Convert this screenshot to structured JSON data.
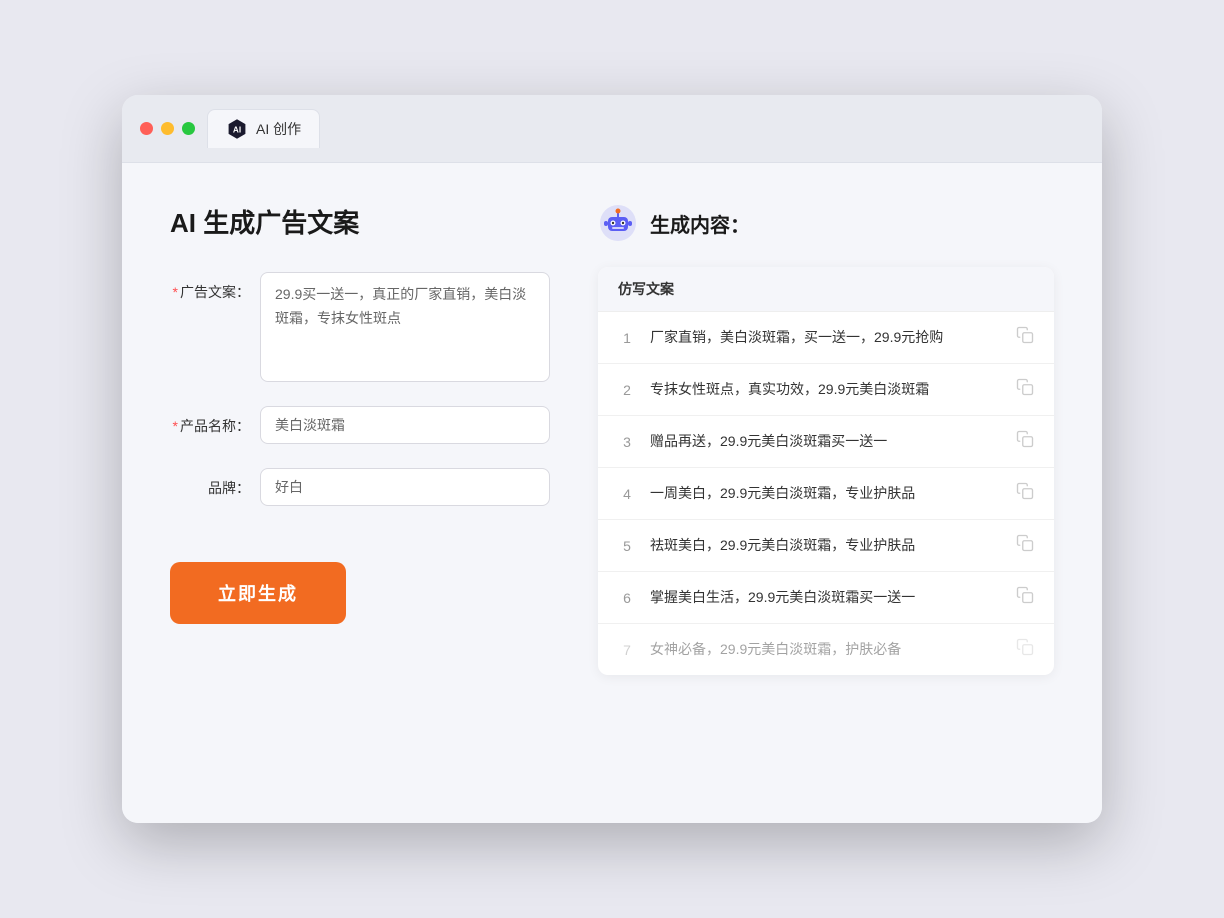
{
  "window": {
    "tab_label": "AI 创作"
  },
  "left_panel": {
    "title": "AI 生成广告文案",
    "fields": [
      {
        "id": "ad_copy",
        "label": "广告文案：",
        "required": true,
        "type": "textarea",
        "value": "29.9买一送一，真正的厂家直销，美白淡斑霜，专抹女性斑点"
      },
      {
        "id": "product_name",
        "label": "产品名称：",
        "required": true,
        "type": "input",
        "value": "美白淡斑霜"
      },
      {
        "id": "brand",
        "label": "品牌：",
        "required": false,
        "type": "input",
        "value": "好白"
      }
    ],
    "generate_btn": "立即生成"
  },
  "right_panel": {
    "title": "生成内容：",
    "table_header": "仿写文案",
    "results": [
      {
        "num": "1",
        "text": "厂家直销，美白淡斑霜，买一送一，29.9元抢购",
        "faded": false
      },
      {
        "num": "2",
        "text": "专抹女性斑点，真实功效，29.9元美白淡斑霜",
        "faded": false
      },
      {
        "num": "3",
        "text": "赠品再送，29.9元美白淡斑霜买一送一",
        "faded": false
      },
      {
        "num": "4",
        "text": "一周美白，29.9元美白淡斑霜，专业护肤品",
        "faded": false
      },
      {
        "num": "5",
        "text": "祛斑美白，29.9元美白淡斑霜，专业护肤品",
        "faded": false
      },
      {
        "num": "6",
        "text": "掌握美白生活，29.9元美白淡斑霜买一送一",
        "faded": false
      },
      {
        "num": "7",
        "text": "女神必备，29.9元美白淡斑霜，护肤必备",
        "faded": true
      }
    ]
  }
}
